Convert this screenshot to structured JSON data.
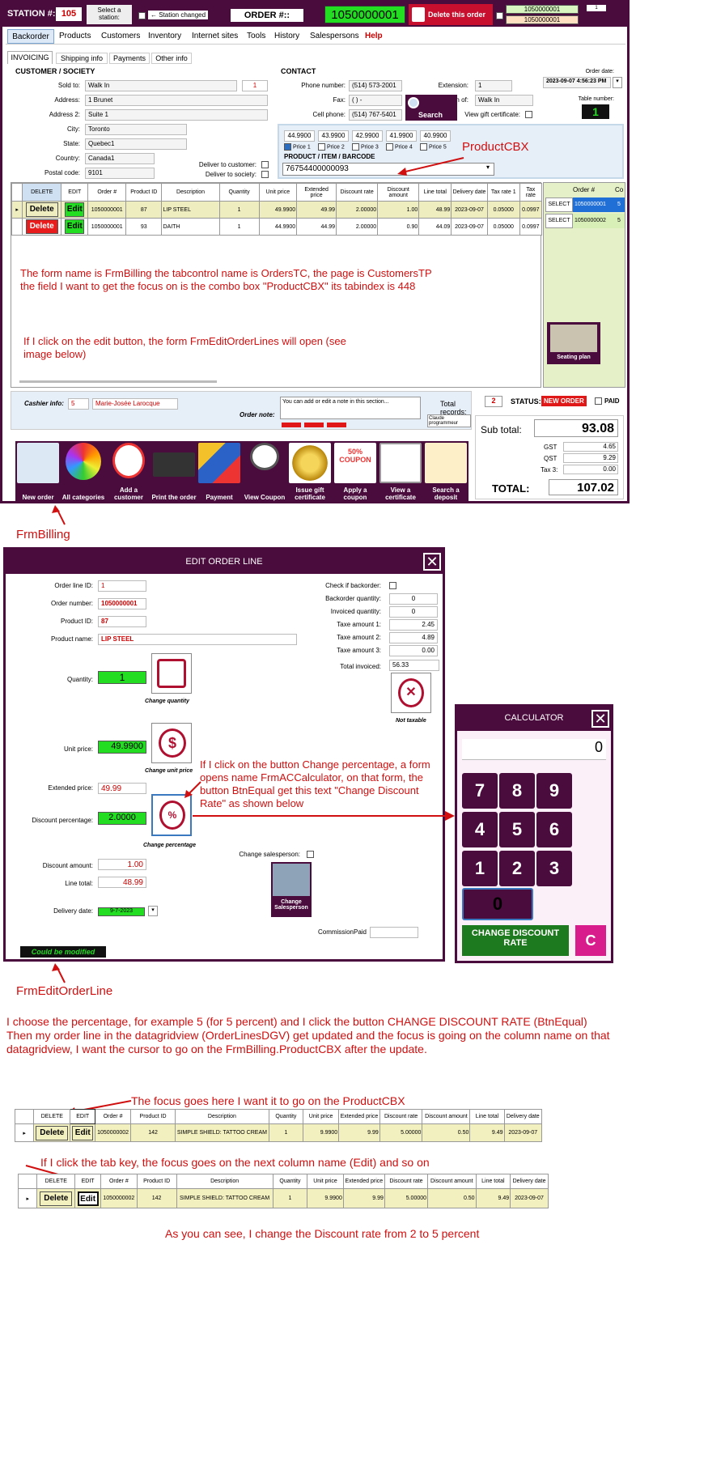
{
  "topbar": {
    "station_label": "STATION #:",
    "station_value": "105",
    "select_station": "Select a station:",
    "station_changed": "← Station changed",
    "order_label": "ORDER #::",
    "order_number": "1050000001",
    "delete_order": "Delete this order",
    "order_a": "1050000001",
    "order_b": "1050000001",
    "order_c": "1"
  },
  "menu": [
    "Backorder",
    "Products",
    "Customers",
    "Inventory",
    "Internet sites",
    "Tools",
    "History",
    "Salespersons",
    "Help"
  ],
  "tabs": [
    "INVOICING",
    "Shipping info",
    "Payments",
    "Other info"
  ],
  "customer": {
    "title": "CUSTOMER / SOCIETY",
    "sold_to_label": "Sold to:",
    "sold_to": "Walk In",
    "sold_to_id": "1",
    "address_label": "Address:",
    "address": "1 Brunet",
    "address2_label": "Address 2:",
    "address2": "Suite 1",
    "city_label": "City:",
    "city": "Toronto",
    "state_label": "State:",
    "state": "Quebec1",
    "country_label": "Country:",
    "country": "Canada1",
    "postal_label": "Postal code:",
    "postal": "9101",
    "deliver_customer": "Deliver to customer:",
    "deliver_society": "Deliver to society:"
  },
  "contact": {
    "title": "CONTACT",
    "phone_label": "Phone number:",
    "phone": "(514) 573-2001",
    "ext_label": "Extension:",
    "ext": "1",
    "fax_label": "Fax:",
    "fax": "(   )    -",
    "cell_label": "Cell phone:",
    "cell": "(514) 767-5401",
    "on_label": "on of:",
    "on_value": "Walk In",
    "gift_label": "View gift certificate:",
    "search": "Search"
  },
  "order_info": {
    "date_label": "Order date:",
    "date": "2023-09-07 4:56:23 PM",
    "table_label": "Table number:",
    "table": "1"
  },
  "prices": {
    "values": [
      "44.9900",
      "43.9900",
      "42.9900",
      "41.9900",
      "40.9900"
    ],
    "labels": [
      "Price 1",
      "Price 2",
      "Price 3",
      "Price 4",
      "Price 5"
    ],
    "product_label": "PRODUCT / ITEM / BARCODE",
    "barcode": "76754400000093",
    "annotation": "ProductCBX"
  },
  "grid": {
    "headers": [
      "DELETE",
      "EDIT",
      "Order #",
      "Product ID",
      "Description",
      "Quantity",
      "Unit price",
      "Extended price",
      "Discount rate",
      "Discount amount",
      "Line total",
      "Delivery date",
      "Tax rate 1",
      "Tax rate"
    ],
    "delete": "Delete",
    "edit": "Edit",
    "rows": [
      [
        "1050000001",
        "87",
        "LIP STEEL",
        "1",
        "49.9900",
        "49.99",
        "2.00000",
        "1.00",
        "48.99",
        "2023-09-07",
        "0.05000",
        "0.0997"
      ],
      [
        "1050000001",
        "93",
        "DAITH",
        "1",
        "44.9900",
        "44.99",
        "2.00000",
        "0.90",
        "44.09",
        "2023-09-07",
        "0.05000",
        "0.0997"
      ]
    ]
  },
  "side_grid": {
    "header": "Order #",
    "header2": "Co",
    "select": "SELECT",
    "rows": [
      "1050000001",
      "1050000002"
    ],
    "counts": [
      "5",
      "5"
    ],
    "seating": "Seating plan"
  },
  "annotations": {
    "a1": "The form name is FrmBilling the tabcontrol name is OrdersTC, the page is CustomersTP",
    "a2": "the field I want to get the focus on is the combo box \"ProductCBX\" its tabindex is 448",
    "a3": "If I click on the edit button, the form FrmEditOrderLines will open (see",
    "a4": "image below)",
    "frmbilling": "FrmBilling",
    "frmedit": "FrmEditOrderLine",
    "calc_note": "If I click on the button Change percentage, a form opens name FrmACCalculator, on that form, the button BtnEqual get this text \"Change Discount Rate\" as shown below",
    "b1": "I choose the percentage, for example 5 (for 5 percent) and I click the button CHANGE DISCOUNT RATE (BtnEqual)",
    "b2": "Then my order line in the datagridview (OrderLinesDGV) get updated and the focus is going on the column name on that",
    "b3": "datagridview, I want the cursor to go on the FrmBilling.ProductCBX after the update.",
    "c1": "The focus goes here I want it to go on the ProductCBX",
    "c2": "If I click the tab key, the focus goes on the next column name (Edit) and so on",
    "c3": "As you can see, I change the Discount rate from 2 to 5 percent"
  },
  "bottom": {
    "cashier_label": "Cashier info:",
    "cashier_id": "5",
    "cashier_name": "Marie-Josée Larocque",
    "note_label": "Order note:",
    "note_hint": "You can add or edit a note in this section...",
    "claude": "Claude programmeur",
    "records_label": "Total records:",
    "records": "2",
    "status_label": "STATUS:",
    "status": "NEW ORDER",
    "paid": "PAID"
  },
  "totals": {
    "sub_label": "Sub total:",
    "sub": "93.08",
    "gst_label": "GST",
    "gst": "4.65",
    "qst_label": "QST",
    "qst": "9.29",
    "tax3_label": "Tax 3:",
    "tax3": "0.00",
    "total_label": "TOTAL:",
    "total": "107.02"
  },
  "icons": [
    "New order",
    "All categories",
    "Add a customer",
    "Print the order",
    "Payment",
    "View Coupon",
    "Issue gift certificate",
    "Apply a coupon",
    "View a certificate",
    "Search a deposit"
  ],
  "coupon_text": "50% COUPON",
  "edit_form": {
    "title": "EDIT ORDER LINE",
    "line_id_label": "Order line ID:",
    "line_id": "1",
    "order_label": "Order number:",
    "order": "1050000001",
    "pid_label": "Product ID:",
    "pid": "87",
    "pname_label": "Product name:",
    "pname": "LIP STEEL",
    "qty_label": "Quantity:",
    "qty": "1",
    "change_qty": "Change quantity",
    "unit_label": "Unit price:",
    "unit": "49.9900",
    "change_unit": "Change unit price",
    "ext_label": "Extended price:",
    "ext": "49.99",
    "disc_label": "Discount percentage:",
    "disc": "2.0000",
    "change_pct": "Change percentage",
    "damount_label": "Discount amount:",
    "damount": "1.00",
    "ltotal_label": "Line total:",
    "ltotal": "48.99",
    "delivery_label": "Delivery date:",
    "delivery": "9-7-2023",
    "backorder_label": "Check if backorder:",
    "boq_label": "Backorder quantity:",
    "boq": "0",
    "invq_label": "Invoiced quantity:",
    "invq": "0",
    "t1_label": "Taxe amount 1:",
    "t1": "2.45",
    "t2_label": "Taxe amount 2:",
    "t2": "4.89",
    "t3_label": "Taxe amount 3:",
    "t3": "0.00",
    "tinv_label": "Total invoiced:",
    "tinv": "56.33",
    "not_taxable": "Not taxable",
    "salesperson_label": "Change salesperson:",
    "change_sales": "Change Salesperson",
    "commission_label": "CommissionPaid",
    "modified": "Could be modified"
  },
  "calculator": {
    "title": "CALCULATOR",
    "display": "0",
    "keys": [
      "7",
      "8",
      "9",
      "4",
      "5",
      "6",
      "1",
      "2",
      "3"
    ],
    "zero": "0",
    "equal": "CHANGE DISCOUNT RATE",
    "clear": "C"
  },
  "grid2": {
    "headers": [
      "DELETE",
      "EDIT",
      "Order #",
      "Product ID",
      "Description",
      "Quantity",
      "Unit price",
      "Extended price",
      "Discount rate",
      "Discount amount",
      "Line total",
      "Delivery date"
    ],
    "row": [
      "1050000002",
      "142",
      "SIMPLE SHIELD: TATTOO CREAM",
      "1",
      "9.9900",
      "9.99",
      "5.00000",
      "0.50",
      "9.49",
      "2023-09-07"
    ],
    "delete": "Delete",
    "edit": "Edit"
  }
}
